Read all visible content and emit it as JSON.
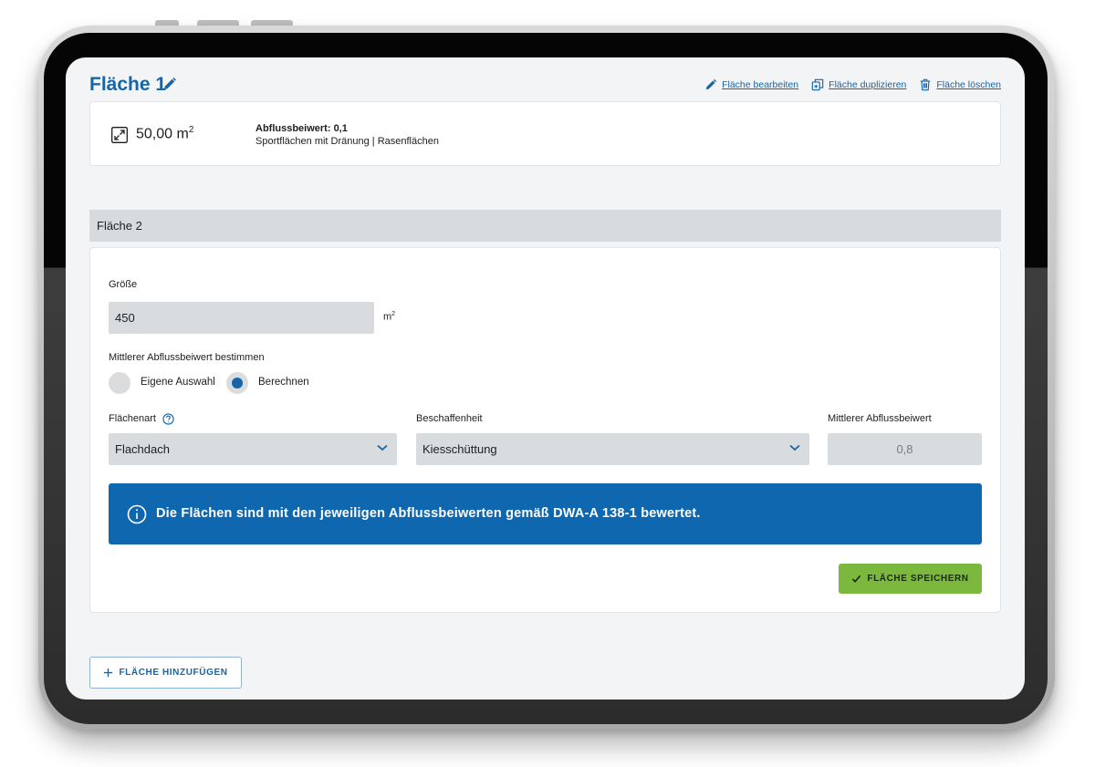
{
  "colors": {
    "primary": "#1565a8",
    "banner": "#0f67b0",
    "success": "#7cb83e",
    "field_bg": "#d9dcdf",
    "screen_bg": "#f3f4f6"
  },
  "flaeche1": {
    "title": "Fläche 1",
    "actions": {
      "edit": "Fläche bearbeiten",
      "duplicate": "Fläche duplizieren",
      "delete": "Fläche löschen"
    },
    "area_value": "50,00 m",
    "area_unit_exp": "2",
    "coeff_label": "Abflussbeiwert: 0,1",
    "coeff_desc": "Sportflächen mit Dränung | Rasenflächen"
  },
  "flaeche2": {
    "title": "Fläche 2",
    "size_label": "Größe",
    "size_value": "450",
    "size_unit": "m",
    "size_unit_exp": "2",
    "coeff_mode_label": "Mittlerer Abflussbeiwert bestimmen",
    "radio_options": [
      {
        "label": "Eigene Auswahl",
        "checked": false
      },
      {
        "label": "Berechnen",
        "checked": true
      }
    ],
    "flaechenart_label": "Flächenart",
    "flaechenart_value": "Flachdach",
    "beschaffenheit_label": "Beschaffenheit",
    "beschaffenheit_value": "Kiesschüttung",
    "mittlerer_label": "Mittlerer Abflussbeiwert",
    "mittlerer_value": "0,8",
    "info_text": "Die Flächen sind mit den jeweiligen Abflussbeiwerten gemäß DWA-A 138-1 bewertet.",
    "save_label": "FLÄCHE SPEICHERN"
  },
  "add_label": "FLÄCHE HINZUFÜGEN",
  "icons": {
    "title_edit": "pencil-icon",
    "edit": "pencil-icon",
    "duplicate": "duplicate-icon",
    "delete": "trash-icon",
    "area": "resize-icon",
    "help": "help-icon",
    "info": "info-icon",
    "dropdown": "chevron-down-icon",
    "save": "check-icon",
    "add": "plus-icon"
  }
}
